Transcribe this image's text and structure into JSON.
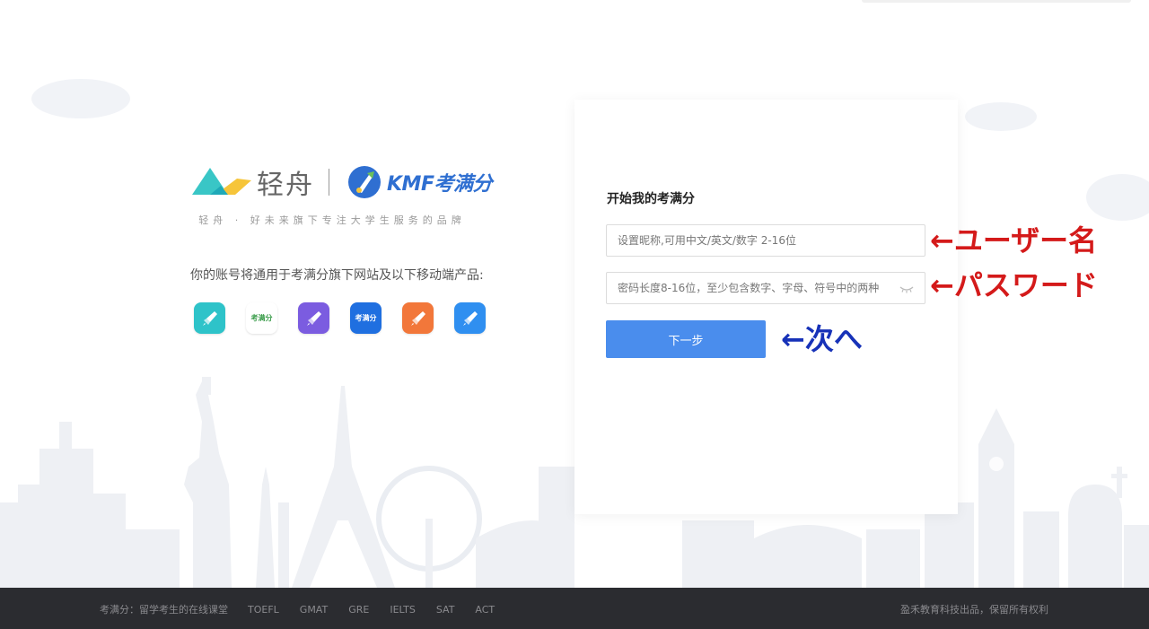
{
  "brand": {
    "qingzhou_name": "轻舟",
    "kmf_latin": "KMF",
    "kmf_cn": "考满分",
    "tagline": "轻舟 · 好未来旗下专注大学生服务的品牌",
    "products_title": "你的账号将通用于考满分旗下网站及以下移动端产品:",
    "apps": [
      {
        "icon": "rocket-icon",
        "color": "#2ec3c9",
        "label": ""
      },
      {
        "icon": "kmf-green-icon",
        "color": "#ffffff",
        "label": "考满分"
      },
      {
        "icon": "rocket-icon",
        "color": "#7b5ce0",
        "label": ""
      },
      {
        "icon": "kmf-blue-icon",
        "color": "#1f6fe0",
        "label": "考满分"
      },
      {
        "icon": "rocket-icon",
        "color": "#f2773a",
        "label": ""
      },
      {
        "icon": "rocket-icon",
        "color": "#2f8ff0",
        "label": ""
      }
    ]
  },
  "login": {
    "title": "开始我的考满分",
    "username_placeholder": "设置昵称,可用中文/英文/数字 2-16位",
    "password_placeholder": "密码长度8-16位，至少包含数字、字母、符号中的两种",
    "next_label": "下一步"
  },
  "annotations": {
    "username": "←ユーザー名",
    "password": "←パスワード",
    "next": "←次へ"
  },
  "footer": {
    "slogan": "考满分：留学考生的在线课堂",
    "links": [
      "TOEFL",
      "GMAT",
      "GRE",
      "IELTS",
      "SAT",
      "ACT"
    ],
    "copyright": "盈禾教育科技出品，保留所有权利"
  },
  "colors": {
    "primary": "#4a8ded",
    "footer_bg": "#2b2c30",
    "annotation_red": "#d41a1a",
    "annotation_blue": "#1732b8"
  }
}
